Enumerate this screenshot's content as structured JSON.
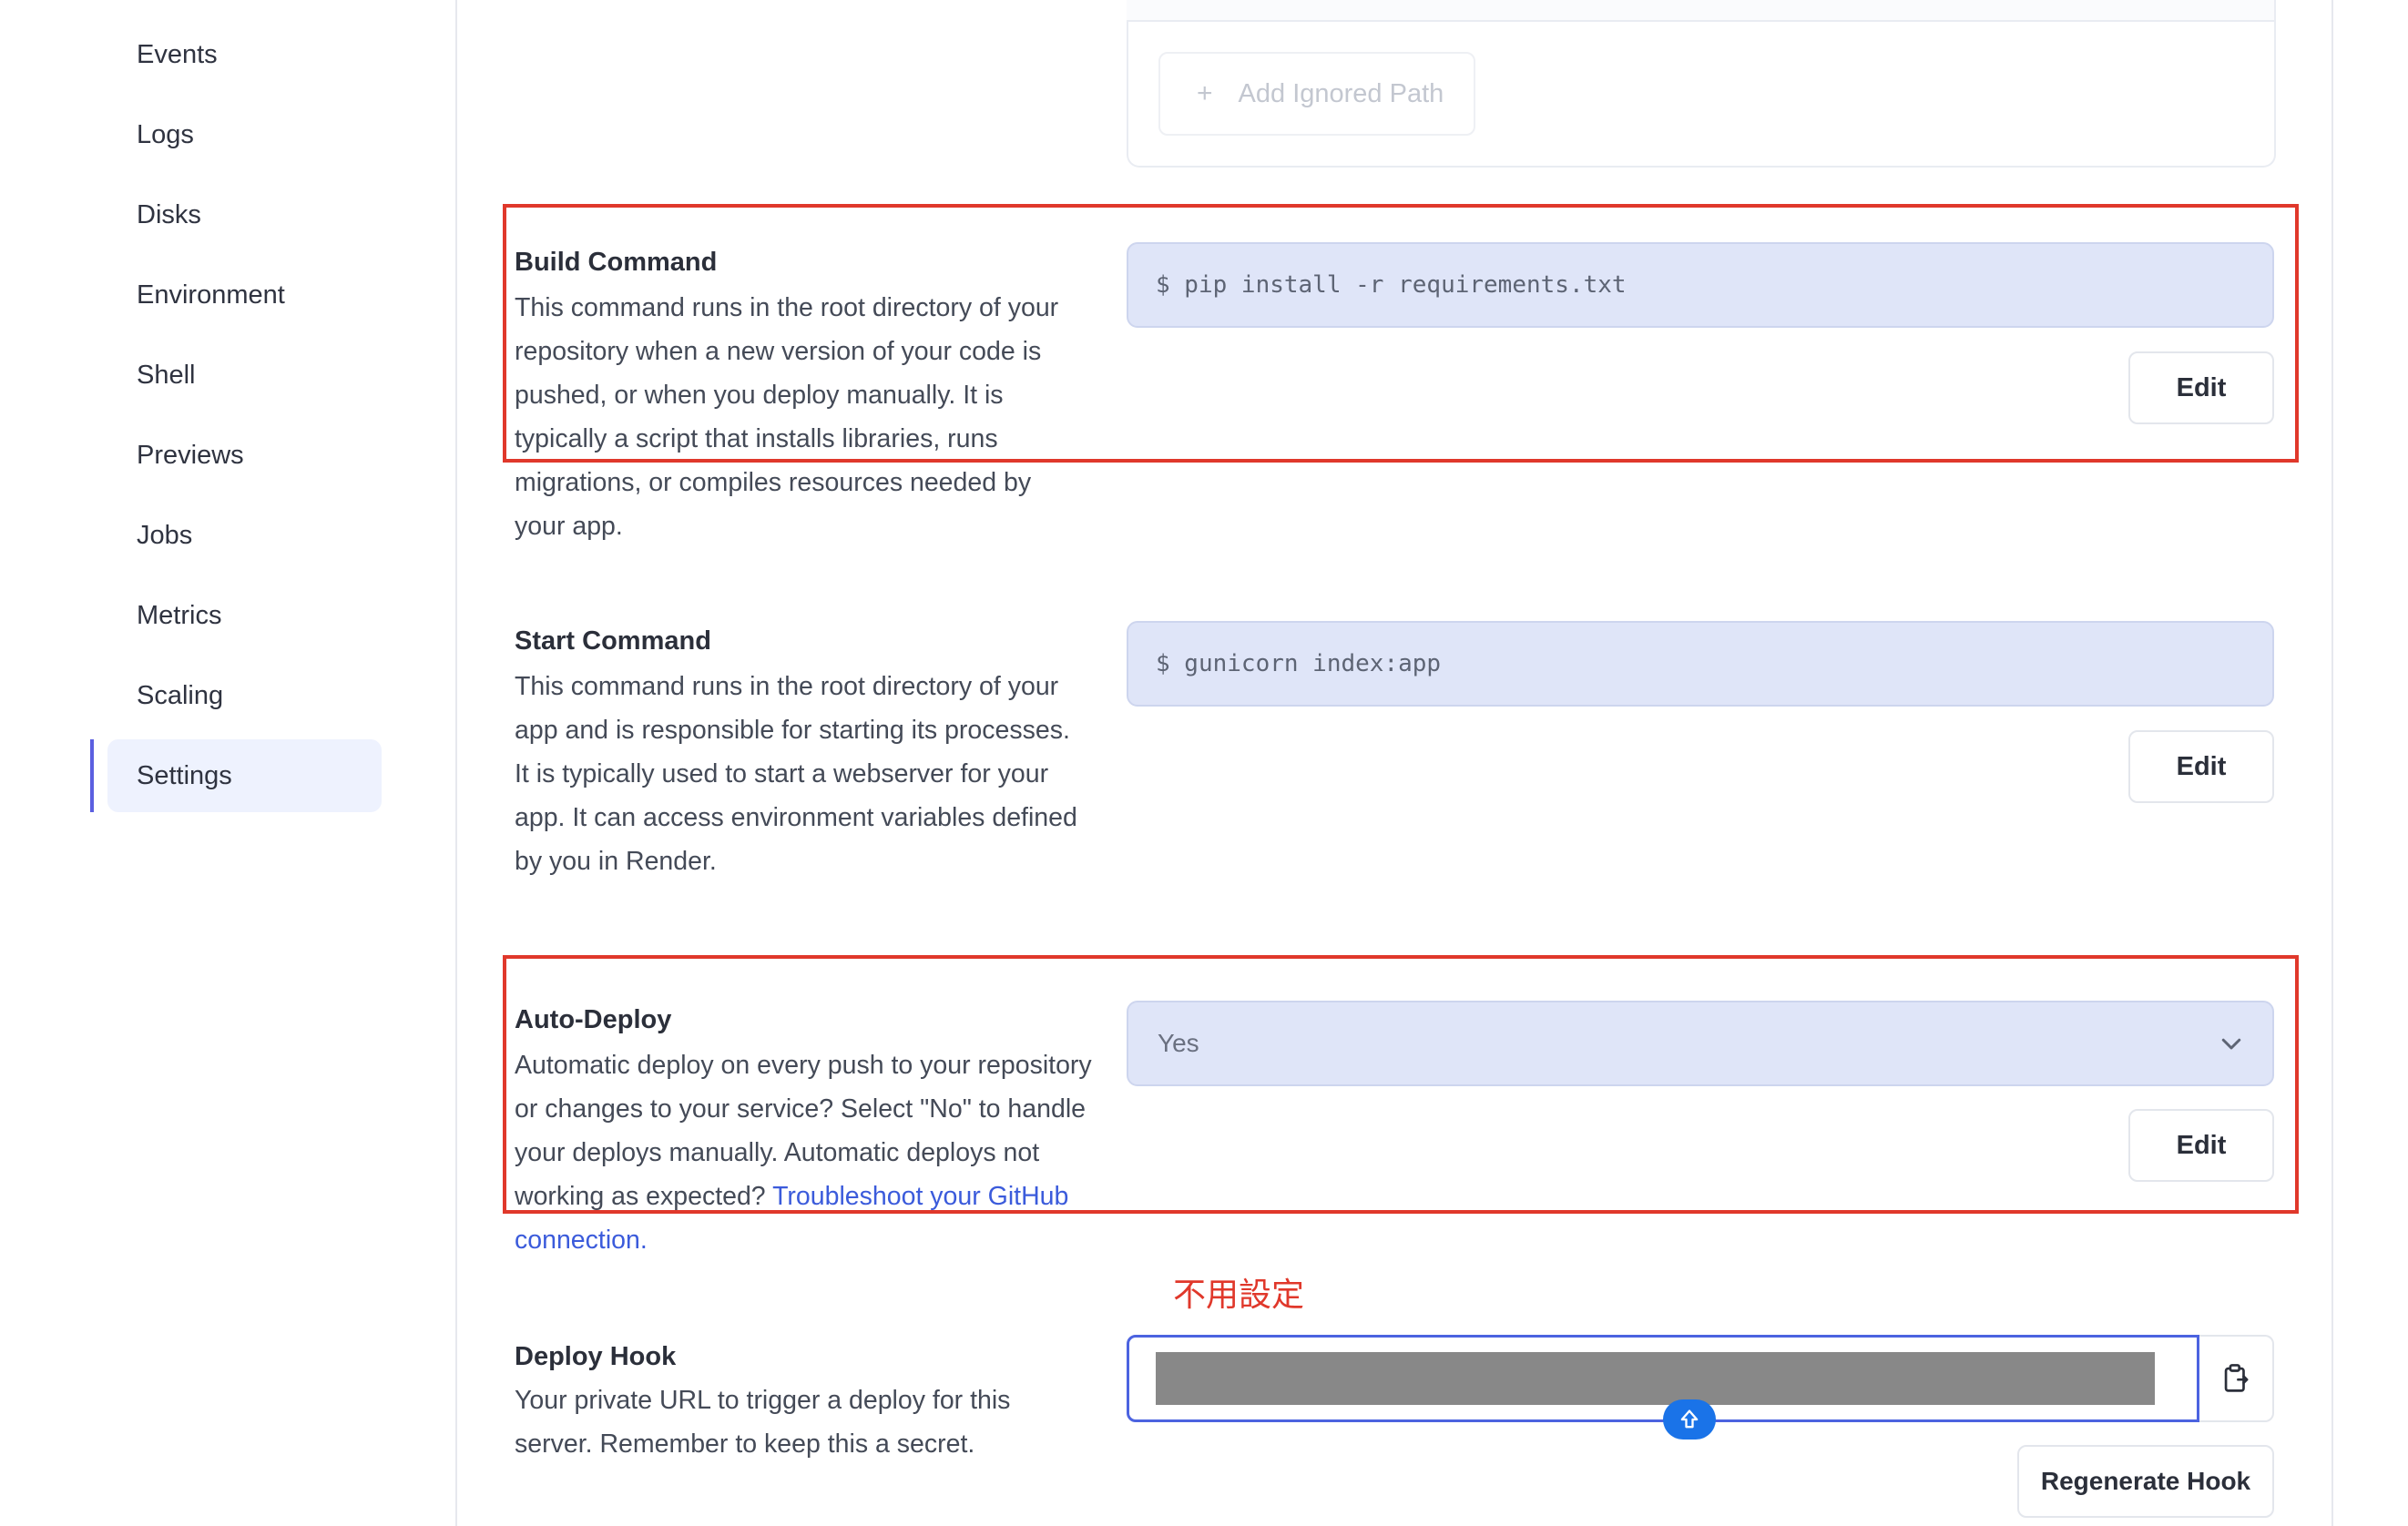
{
  "sidebar": {
    "items": [
      {
        "label": "Events"
      },
      {
        "label": "Logs"
      },
      {
        "label": "Disks"
      },
      {
        "label": "Environment"
      },
      {
        "label": "Shell"
      },
      {
        "label": "Previews"
      },
      {
        "label": "Jobs"
      },
      {
        "label": "Metrics"
      },
      {
        "label": "Scaling"
      },
      {
        "label": "Settings",
        "active": true
      }
    ]
  },
  "ignored_paths": {
    "add_label": "Add Ignored Path",
    "add_icon": "plus-icon"
  },
  "build_command": {
    "title": "Build Command",
    "description": "This command runs in the root directory of your repository when a new version of your code is pushed, or when you deploy manually. It is typically a script that installs libraries, runs migrations, or compiles resources needed by your app.",
    "value": "$ pip install -r requirements.txt",
    "edit_label": "Edit"
  },
  "start_command": {
    "title": "Start Command",
    "description": "This command runs in the root directory of your app and is responsible for starting its processes. It is typically used to start a webserver for your app. It can access environment variables defined by you in Render.",
    "value": "$ gunicorn index:app",
    "edit_label": "Edit"
  },
  "auto_deploy": {
    "title": "Auto-Deploy",
    "description": "Automatic deploy on every push to your repository or changes to your service? Select \"No\" to handle your deploys manually. Automatic deploys not working as expected?",
    "link_text": "Troubleshoot your GitHub connection.",
    "selected": "Yes",
    "edit_label": "Edit"
  },
  "deploy_hook": {
    "title": "Deploy Hook",
    "description": "Your private URL to trigger a deploy for this server. Remember to keep this a secret.",
    "regenerate_label": "Regenerate Hook"
  },
  "annotation": {
    "note": "不用設定",
    "color": "#e0382b"
  },
  "colors": {
    "accent": "#5b5fe0",
    "field_bg": "#dfe5f8",
    "link": "#3b5bdb"
  }
}
